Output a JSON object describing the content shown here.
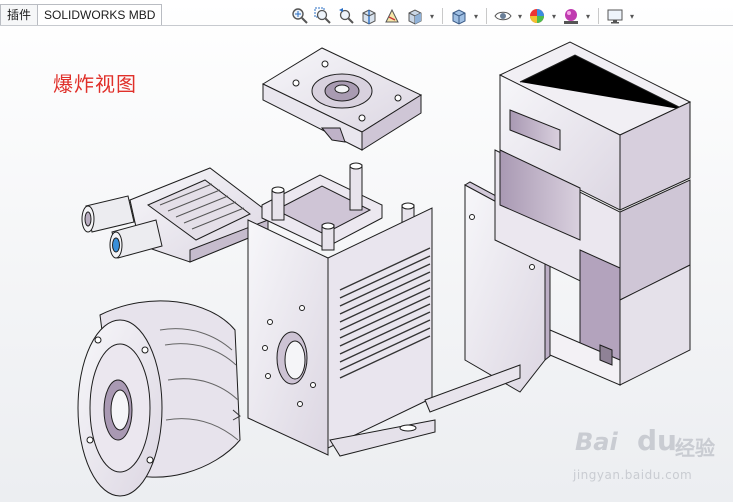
{
  "tabs": [
    {
      "label": "插件"
    },
    {
      "label": "SOLIDWORKS MBD"
    }
  ],
  "viewbar": {
    "icons": [
      "zoom-to-fit-icon",
      "zoom-area-icon",
      "previous-view-icon",
      "section-view-icon",
      "dynamic-annotation-icon",
      "view-orientation-icon",
      "display-style-icon",
      "hide-show-items-icon",
      "edit-appearance-icon",
      "apply-scene-icon",
      "view-settings-icon"
    ]
  },
  "canvas": {
    "label": "爆炸视图"
  },
  "watermark": {
    "brand": "Bai",
    "paw": "du",
    "cn": "经验",
    "url": "jingyan.baidu.com"
  },
  "colors": {
    "part_fill": "#f4f4f7",
    "part_shade": "#b8a9bf",
    "part_dark": "#8f8296",
    "edge": "#1e1e1e",
    "label_red": "#e0302a"
  }
}
